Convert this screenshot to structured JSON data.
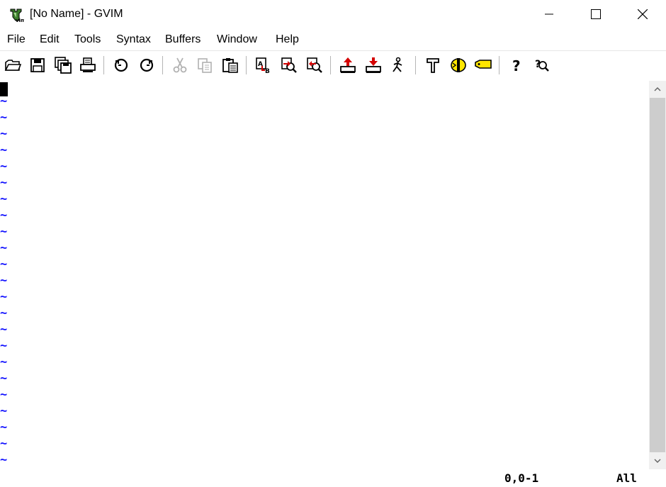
{
  "window": {
    "title": "[No Name] - GVIM",
    "app_icon": "gvim-icon",
    "controls": [
      "minimize-icon",
      "maximize-icon",
      "close-icon"
    ]
  },
  "menubar": {
    "items": [
      "File",
      "Edit",
      "Tools",
      "Syntax",
      "Buffers",
      "Window",
      "Help"
    ]
  },
  "toolbar": {
    "buttons": [
      {
        "icon": "open-icon",
        "enabled": true
      },
      {
        "icon": "save-icon",
        "enabled": true
      },
      {
        "icon": "save-all-icon",
        "enabled": true
      },
      {
        "icon": "print-icon",
        "enabled": true
      },
      {
        "icon": "undo-icon",
        "enabled": true
      },
      {
        "icon": "redo-icon",
        "enabled": true
      },
      {
        "icon": "cut-icon",
        "enabled": false
      },
      {
        "icon": "copy-icon",
        "enabled": false
      },
      {
        "icon": "paste-icon",
        "enabled": true
      },
      {
        "icon": "replace-icon",
        "enabled": true
      },
      {
        "icon": "find-next-icon",
        "enabled": true
      },
      {
        "icon": "find-prev-icon",
        "enabled": true
      },
      {
        "icon": "load-session-icon",
        "enabled": true
      },
      {
        "icon": "save-session-icon",
        "enabled": true
      },
      {
        "icon": "run-script-icon",
        "enabled": true
      },
      {
        "icon": "make-icon",
        "enabled": true
      },
      {
        "icon": "shell-icon",
        "enabled": true
      },
      {
        "icon": "tag-icon",
        "enabled": true
      },
      {
        "icon": "help-icon",
        "enabled": true
      },
      {
        "icon": "find-help-icon",
        "enabled": true
      }
    ]
  },
  "editor": {
    "empty_line_marker": "~",
    "tilde_line_count": 23,
    "marker_color": "#1414ff"
  },
  "statusline": {
    "position": "0,0-1",
    "scroll": "All"
  }
}
